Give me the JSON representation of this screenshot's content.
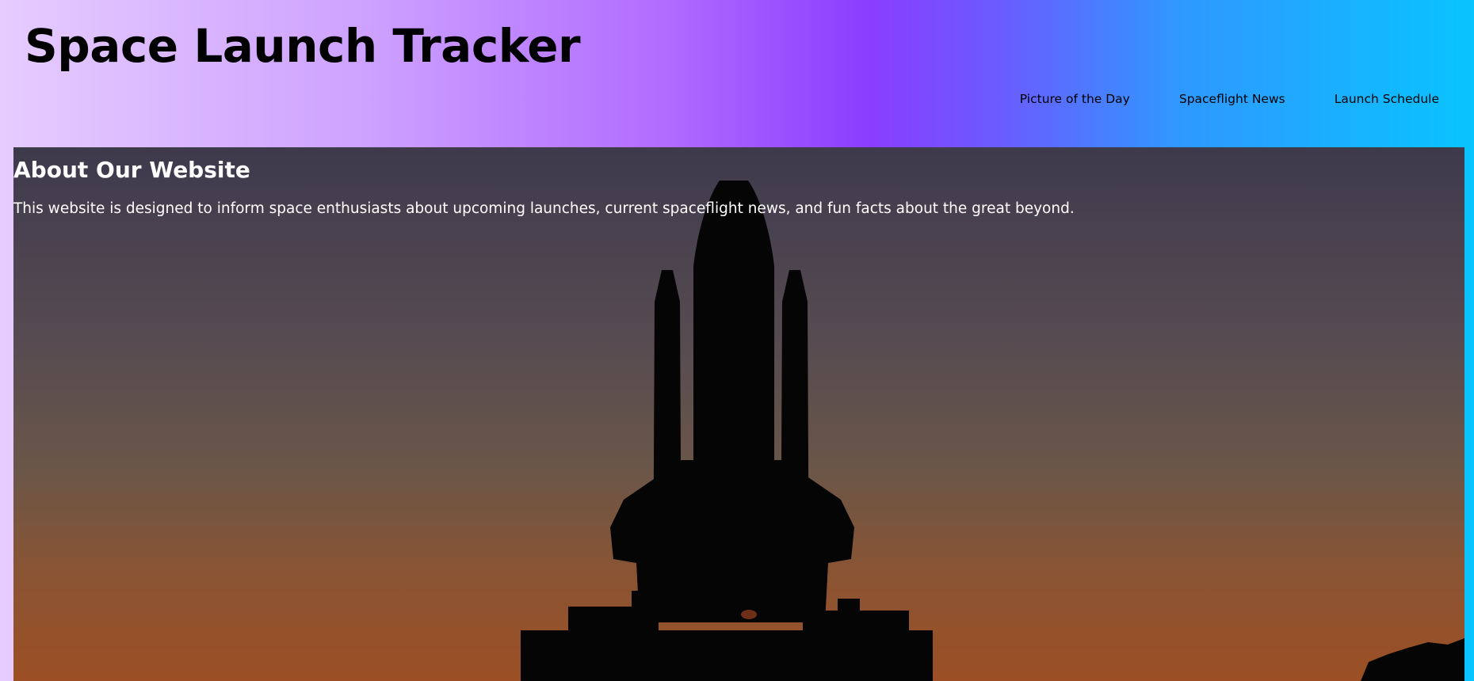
{
  "header": {
    "title": "Space Launch Tracker",
    "nav": [
      {
        "label": "Picture of the Day"
      },
      {
        "label": "Spaceflight News"
      },
      {
        "label": "Launch Schedule"
      }
    ]
  },
  "about": {
    "heading": "About Our Website",
    "text": "This website is designed to inform space enthusiasts about upcoming launches, current spaceflight news, and fun facts about the great beyond."
  },
  "hero_image": {
    "subject": "space-shuttle-silhouette-at-dusk"
  },
  "colors": {
    "gradient_left": "#e6ccff",
    "gradient_mid": "#8a3dff",
    "gradient_right": "#08c4ff",
    "sky_top": "#3d3a4c",
    "sky_bottom": "#9c4f24",
    "text_light": "#ffffff"
  }
}
